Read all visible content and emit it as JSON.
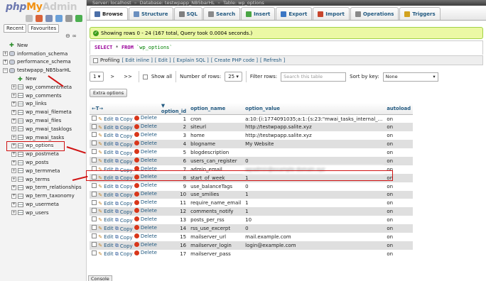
{
  "logo": {
    "php": "php",
    "my": "My",
    "admin": "Admin"
  },
  "sidebar": {
    "tabs": [
      "Recent",
      "Favourites"
    ],
    "tree": [
      {
        "label": "New",
        "level": 1,
        "icon": "new-icon"
      },
      {
        "label": "information_schema",
        "level": 1,
        "icon": "database-icon"
      },
      {
        "label": "performance_schema",
        "level": 1,
        "icon": "database-icon"
      },
      {
        "label": "testwpapp_NB5barHL",
        "level": 1,
        "icon": "database-icon"
      },
      {
        "label": "New",
        "level": 2,
        "icon": "new-icon"
      },
      {
        "label": "wp_commentmeta",
        "level": 2,
        "icon": "table-icon"
      },
      {
        "label": "wp_comments",
        "level": 2,
        "icon": "table-icon"
      },
      {
        "label": "wp_links",
        "level": 2,
        "icon": "table-icon"
      },
      {
        "label": "wp_mwai_filemeta",
        "level": 2,
        "icon": "table-icon"
      },
      {
        "label": "wp_mwai_files",
        "level": 2,
        "icon": "table-icon"
      },
      {
        "label": "wp_mwai_tasklogs",
        "level": 2,
        "icon": "table-icon"
      },
      {
        "label": "wp_mwai_tasks",
        "level": 2,
        "icon": "table-icon"
      },
      {
        "label": "wp_options",
        "level": 2,
        "icon": "table-icon"
      },
      {
        "label": "wp_postmeta",
        "level": 2,
        "icon": "table-icon"
      },
      {
        "label": "wp_posts",
        "level": 2,
        "icon": "table-icon"
      },
      {
        "label": "wp_termmeta",
        "level": 2,
        "icon": "table-icon"
      },
      {
        "label": "wp_terms",
        "level": 2,
        "icon": "table-icon"
      },
      {
        "label": "wp_term_relationships",
        "level": 2,
        "icon": "table-icon"
      },
      {
        "label": "wp_term_taxonomy",
        "level": 2,
        "icon": "table-icon"
      },
      {
        "label": "wp_usermeta",
        "level": 2,
        "icon": "table-icon"
      },
      {
        "label": "wp_users",
        "level": 2,
        "icon": "table-icon"
      }
    ]
  },
  "breadcrumb": [
    "Server: localhost",
    "Database: testwpapp_NB5barHL",
    "Table: wp_options"
  ],
  "topnav": [
    {
      "label": "Browse",
      "icon": "browse-icon",
      "color": "#4b6fa8"
    },
    {
      "label": "Structure",
      "icon": "structure-icon",
      "color": "#6a8fbf"
    },
    {
      "label": "SQL",
      "icon": "sql-icon",
      "color": "#7f7f7f"
    },
    {
      "label": "Search",
      "icon": "search-icon",
      "color": "#8a8a8a"
    },
    {
      "label": "Insert",
      "icon": "insert-icon",
      "color": "#4aa544"
    },
    {
      "label": "Export",
      "icon": "export-icon",
      "color": "#3b76c4"
    },
    {
      "label": "Import",
      "icon": "import-icon",
      "color": "#c7462d"
    },
    {
      "label": "Operations",
      "icon": "operations-icon",
      "color": "#888"
    },
    {
      "label": "Triggers",
      "icon": "triggers-icon",
      "color": "#d2a21f"
    }
  ],
  "message": "Showing rows 0 - 24 (167 total, Query took 0.0004 seconds.)",
  "sql": {
    "select": "SELECT",
    "star": "*",
    "from": "FROM",
    "table": "`wp_options`"
  },
  "profiling": {
    "label": "Profiling",
    "links": [
      "[ Edit inline ]",
      "[ Edit ]",
      "[ Explain SQL ]",
      "[ Create PHP code ]",
      "[ Refresh ]"
    ]
  },
  "nav": {
    "page": "1",
    "next": ">",
    "last": ">>",
    "show_all": "Show all",
    "rows_label": "Number of rows:",
    "rows_value": "25",
    "filter_label": "Filter rows:",
    "filter_placeholder": "Search this table",
    "sort_label": "Sort by key:",
    "sort_value": "None"
  },
  "extra_options": "Extra options",
  "table": {
    "arrows": "←T→",
    "columns": [
      "option_id",
      "option_name",
      "option_value",
      "autoload"
    ],
    "actions": {
      "edit": "Edit",
      "copy": "Copy",
      "delete": "Delete"
    },
    "rows": [
      {
        "id": "1",
        "name": "cron",
        "value": "a:10:{i:1774091035;a:1:{s:23:\"mwai_tasks_internal_...",
        "autoload": "on"
      },
      {
        "id": "2",
        "name": "siteurl",
        "value": "http://testwpapp.salite.xyz",
        "autoload": "on"
      },
      {
        "id": "3",
        "name": "home",
        "value": "http://testwpapp.salite.xyz",
        "autoload": "on"
      },
      {
        "id": "4",
        "name": "blogname",
        "value": "My Website",
        "autoload": "on"
      },
      {
        "id": "5",
        "name": "blogdescription",
        "value": "",
        "autoload": "on"
      },
      {
        "id": "6",
        "name": "users_can_register",
        "value": "0",
        "autoload": "on"
      },
      {
        "id": "7",
        "name": "admin_email",
        "value": "wpadmin@example-domain.xyz",
        "autoload": "on",
        "blurred": true
      },
      {
        "id": "8",
        "name": "start_of_week",
        "value": "1",
        "autoload": "on"
      },
      {
        "id": "9",
        "name": "use_balanceTags",
        "value": "0",
        "autoload": "on"
      },
      {
        "id": "10",
        "name": "use_smilies",
        "value": "1",
        "autoload": "on"
      },
      {
        "id": "11",
        "name": "require_name_email",
        "value": "1",
        "autoload": "on"
      },
      {
        "id": "12",
        "name": "comments_notify",
        "value": "1",
        "autoload": "on"
      },
      {
        "id": "13",
        "name": "posts_per_rss",
        "value": "10",
        "autoload": "on"
      },
      {
        "id": "14",
        "name": "rss_use_excerpt",
        "value": "0",
        "autoload": "on"
      },
      {
        "id": "15",
        "name": "mailserver_url",
        "value": "mail.example.com",
        "autoload": "on"
      },
      {
        "id": "16",
        "name": "mailserver_login",
        "value": "login@example.com",
        "autoload": "on"
      },
      {
        "id": "17",
        "name": "mailserver_pass",
        "value": "",
        "autoload": "on"
      }
    ]
  },
  "console": "Console",
  "colors": {
    "annotation_red": "#d01313",
    "success_bg": "#ebf8a4",
    "link": "#235a81"
  }
}
